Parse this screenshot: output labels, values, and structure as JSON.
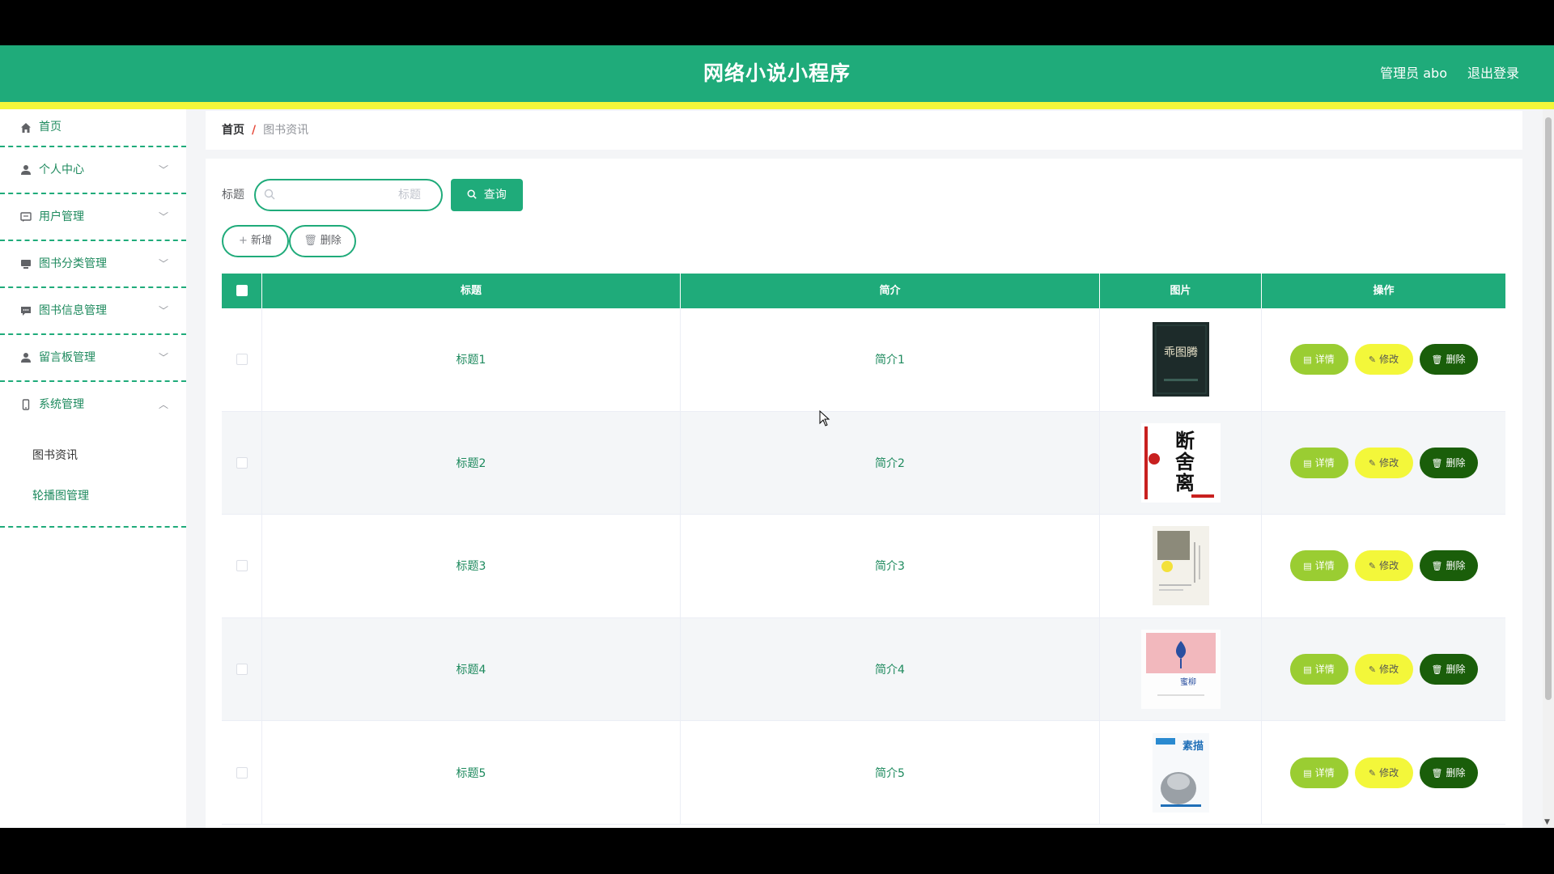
{
  "header": {
    "title": "网络小说小程序",
    "user": "管理员 abo",
    "logout": "退出登录"
  },
  "sidebar": {
    "items": [
      {
        "label": "首页",
        "icon": "home-icon"
      },
      {
        "label": "个人中心",
        "icon": "user-icon"
      },
      {
        "label": "用户管理",
        "icon": "chat-icon"
      },
      {
        "label": "图书分类管理",
        "icon": "monitor-icon"
      },
      {
        "label": "图书信息管理",
        "icon": "message-icon"
      },
      {
        "label": "留言板管理",
        "icon": "user-icon"
      },
      {
        "label": "系统管理",
        "icon": "phone-icon"
      }
    ],
    "sub": [
      "图书资讯",
      "轮播图管理"
    ]
  },
  "breadcrumb": {
    "home": "首页",
    "separator": "/",
    "current": "图书资讯"
  },
  "search": {
    "label": "标题",
    "placeholder": "标题",
    "button": "查询"
  },
  "actions": {
    "add": "新增",
    "delete": "删除"
  },
  "table": {
    "columns": [
      "标题",
      "简介",
      "图片",
      "操作"
    ],
    "rows": [
      {
        "title": "标题1",
        "intro": "简介1"
      },
      {
        "title": "标题2",
        "intro": "简介2"
      },
      {
        "title": "标题3",
        "intro": "简介3"
      },
      {
        "title": "标题4",
        "intro": "简介4"
      },
      {
        "title": "标题5",
        "intro": "简介5"
      }
    ],
    "ops": {
      "detail": "详情",
      "edit": "修改",
      "del": "删除"
    },
    "book_texts": {
      "b1": "乖图腾",
      "b2_lines": [
        "断",
        "舍",
        "离"
      ],
      "b4": "蜜柳",
      "b5": "素描"
    }
  },
  "colors": {
    "primary": "#1fab7a",
    "accent_yellow": "#f3f73a",
    "detail_btn": "#9acd32",
    "delete_btn": "#1a5e0a"
  }
}
